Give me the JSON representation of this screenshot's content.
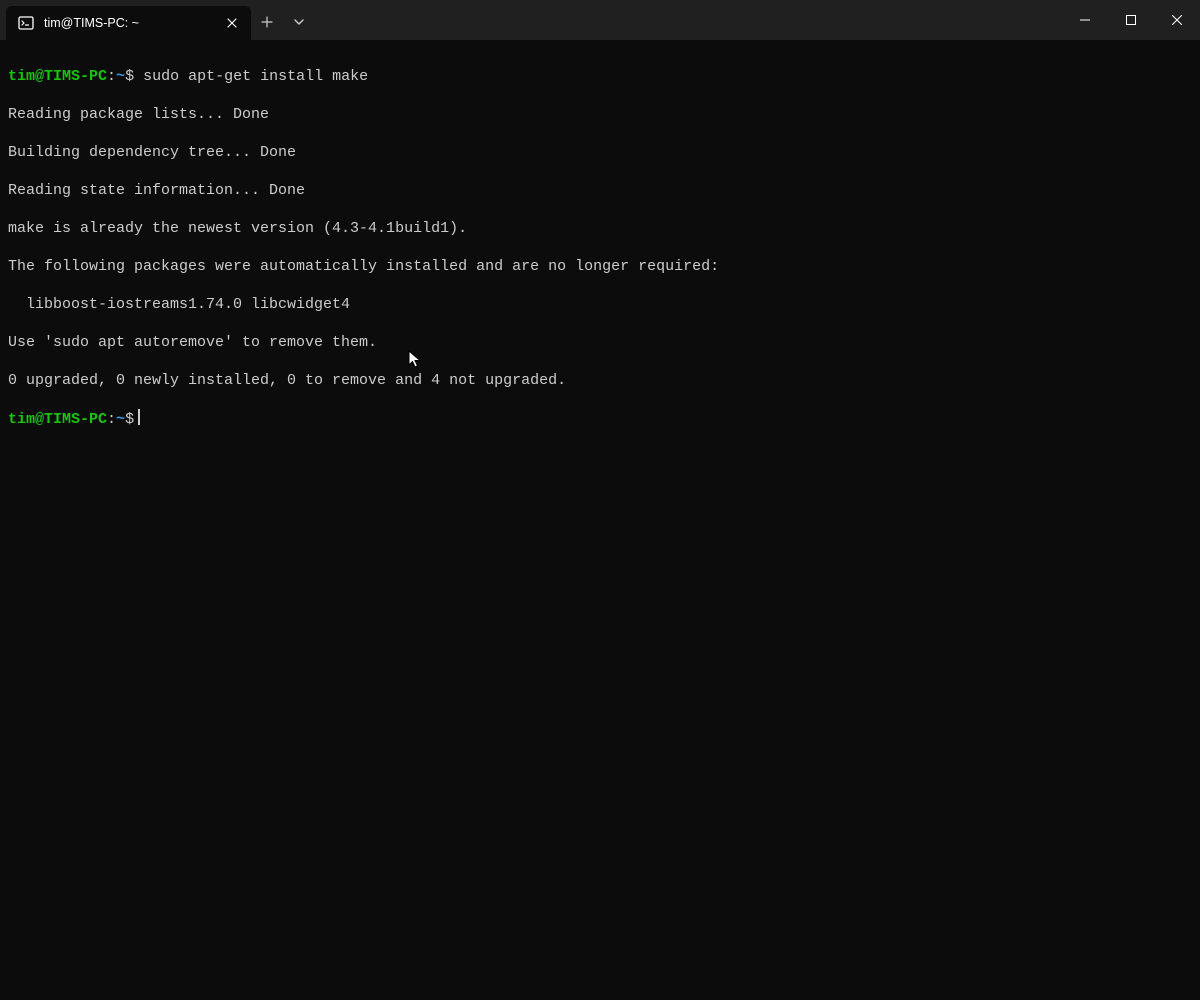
{
  "tab": {
    "title": "tim@TIMS-PC: ~"
  },
  "prompt1": {
    "user_host": "tim@TIMS-PC",
    "colon": ":",
    "path": "~",
    "dollar": "$ ",
    "command": "sudo apt-get install make"
  },
  "output": {
    "l1": "Reading package lists... Done",
    "l2": "Building dependency tree... Done",
    "l3": "Reading state information... Done",
    "l4": "make is already the newest version (4.3-4.1build1).",
    "l5": "The following packages were automatically installed and are no longer required:",
    "l6": "  libboost-iostreams1.74.0 libcwidget4",
    "l7": "Use 'sudo apt autoremove' to remove them.",
    "l8": "0 upgraded, 0 newly installed, 0 to remove and 4 not upgraded."
  },
  "prompt2": {
    "user_host": "tim@TIMS-PC",
    "colon": ":",
    "path": "~",
    "dollar": "$"
  }
}
